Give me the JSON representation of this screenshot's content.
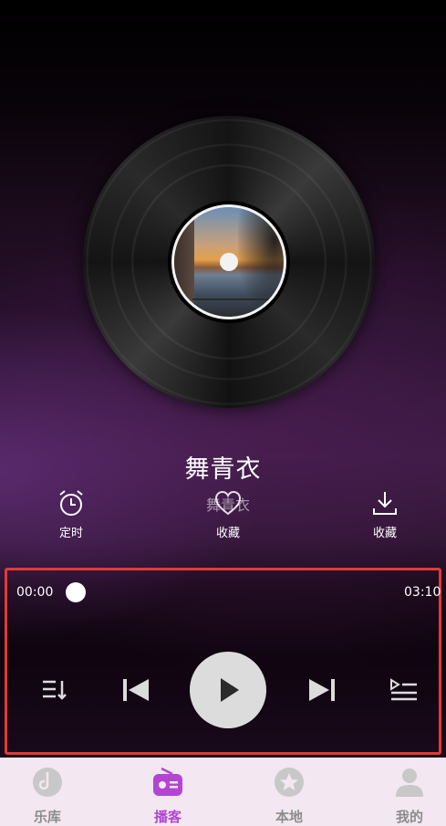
{
  "song": {
    "title": "舞青衣",
    "subtitle": "舞青衣"
  },
  "actions": {
    "timer_label": "定时",
    "favorite_label": "收藏",
    "download_label": "收藏"
  },
  "progress": {
    "current_time": "00:00",
    "total_time": "03:10",
    "fraction": 0.0
  },
  "tabs": [
    {
      "label": "乐库",
      "icon": "music-disc-icon",
      "active": false
    },
    {
      "label": "播客",
      "icon": "radio-icon",
      "active": true
    },
    {
      "label": "本地",
      "icon": "star-icon",
      "active": false
    },
    {
      "label": "我的",
      "icon": "user-icon",
      "active": false
    }
  ],
  "colors": {
    "accent": "#b246d3",
    "highlight_border": "#e53935",
    "tabbar_bg": "#f3e7f1"
  }
}
